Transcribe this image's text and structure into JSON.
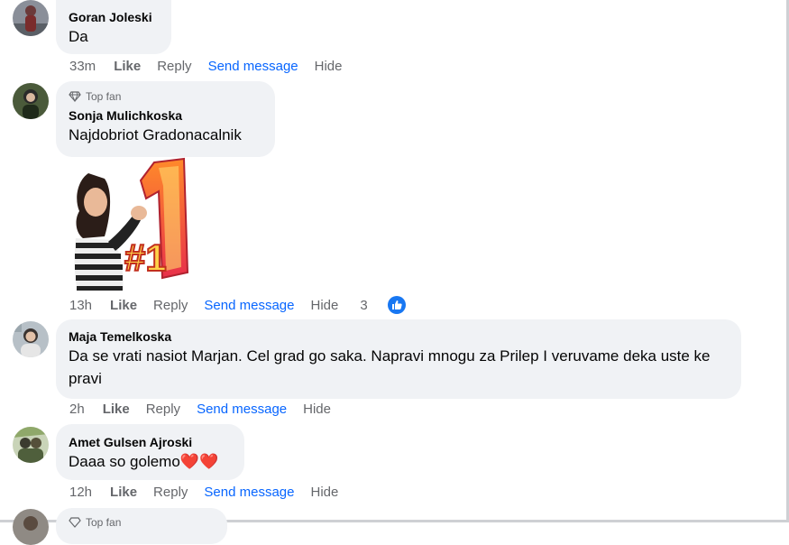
{
  "comments": [
    {
      "author": "Goran Joleski",
      "text": "Da",
      "time": "33m",
      "like": "Like",
      "reply": "Reply",
      "send": "Send message",
      "hide": "Hide"
    },
    {
      "badge": "Top fan",
      "author": "Sonja Mulichkoska",
      "text": "Najdobriot Gradonacalnik",
      "sticker": "#1",
      "time": "13h",
      "like": "Like",
      "reply": "Reply",
      "send": "Send message",
      "hide": "Hide",
      "reaction_count": "3"
    },
    {
      "author": "Maja Temelkoska",
      "text": "Da se vrati nasiot Marjan. Cel grad go saka. Napravi mnogu za Prilep I veruvame deka uste ke pravi",
      "time": "2h",
      "like": "Like",
      "reply": "Reply",
      "send": "Send message",
      "hide": "Hide"
    },
    {
      "author": "Amet Gulsen Ajroski",
      "text": "Daaa so golemo",
      "emoji": "❤️❤️",
      "time": "12h",
      "like": "Like",
      "reply": "Reply",
      "send": "Send message",
      "hide": "Hide"
    },
    {
      "badge": "Top fan"
    }
  ],
  "colors": {
    "bubble": "#f0f2f5",
    "meta": "#65676b",
    "link": "#0866ff",
    "reaction": "#1877f2"
  }
}
